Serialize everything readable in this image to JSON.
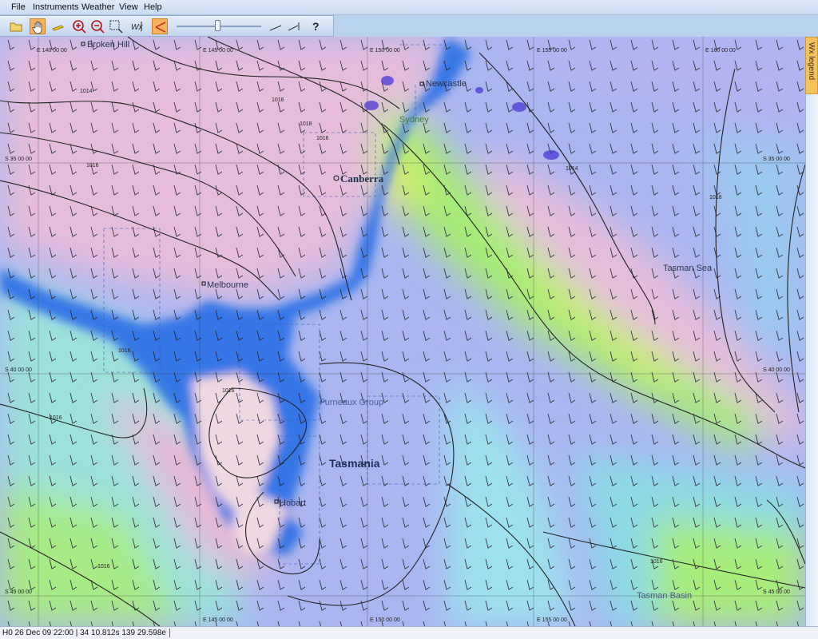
{
  "menu": [
    "File",
    "Instruments",
    "Weather",
    "View",
    "Help"
  ],
  "toolbar": {
    "buttons": [
      "open-icon",
      "pan-hand-icon",
      "pencil-icon",
      "zoom-in-icon",
      "zoom-out-icon",
      "zoom-box-icon",
      "wind-overlay-icon",
      "route-icon",
      "help-icon"
    ],
    "active_button": "route-icon",
    "time_slider_position": 0.48,
    "accent": "#f6b25b"
  },
  "map": {
    "places": {
      "broken_hill": "Broken Hill",
      "newcastle": "Newcastle",
      "sydney": "Sydney",
      "canberra": "Canberra",
      "melbourne": "Melbourne",
      "tasman_sea": "Tasman Sea",
      "furneaux_group": "Furneaux Group",
      "tasmania": "Tasmania",
      "hobart": "Hobart",
      "tasman_basin": "Tasman Basin"
    },
    "longitudes_top": [
      "E 140 00 00",
      "E 145 00 00",
      "E 150 00 00",
      "E 155 00 00",
      "E 160 00 00"
    ],
    "longitudes_bottom": [
      "E 145 00 00",
      "E 150 00 00",
      "E 155 00 00"
    ],
    "latitudes_left": [
      "S 35 00 00",
      "S 40 00 00",
      "S 45 00 00"
    ],
    "latitudes_right": [
      "S 35 00 00",
      "S 40 00 00",
      "S 45 00 00"
    ],
    "isobar_labels": [
      "1014",
      "1016",
      "1018",
      "1016",
      "1016",
      "1014",
      "1018",
      "1016",
      "1016",
      "1016",
      "1016",
      "1016"
    ],
    "colors": {
      "calm": "#e2b8dc",
      "light": "#a9b8f0",
      "moderate": "#8cd2e6",
      "fresh": "#8fe090",
      "strong": "#c4f05a",
      "coast": "#2f72e6"
    }
  },
  "legend_tab": "Wx legend",
  "status": "H0 26 Dec 09 22:00 | 34 10.812s  139 29.598e"
}
